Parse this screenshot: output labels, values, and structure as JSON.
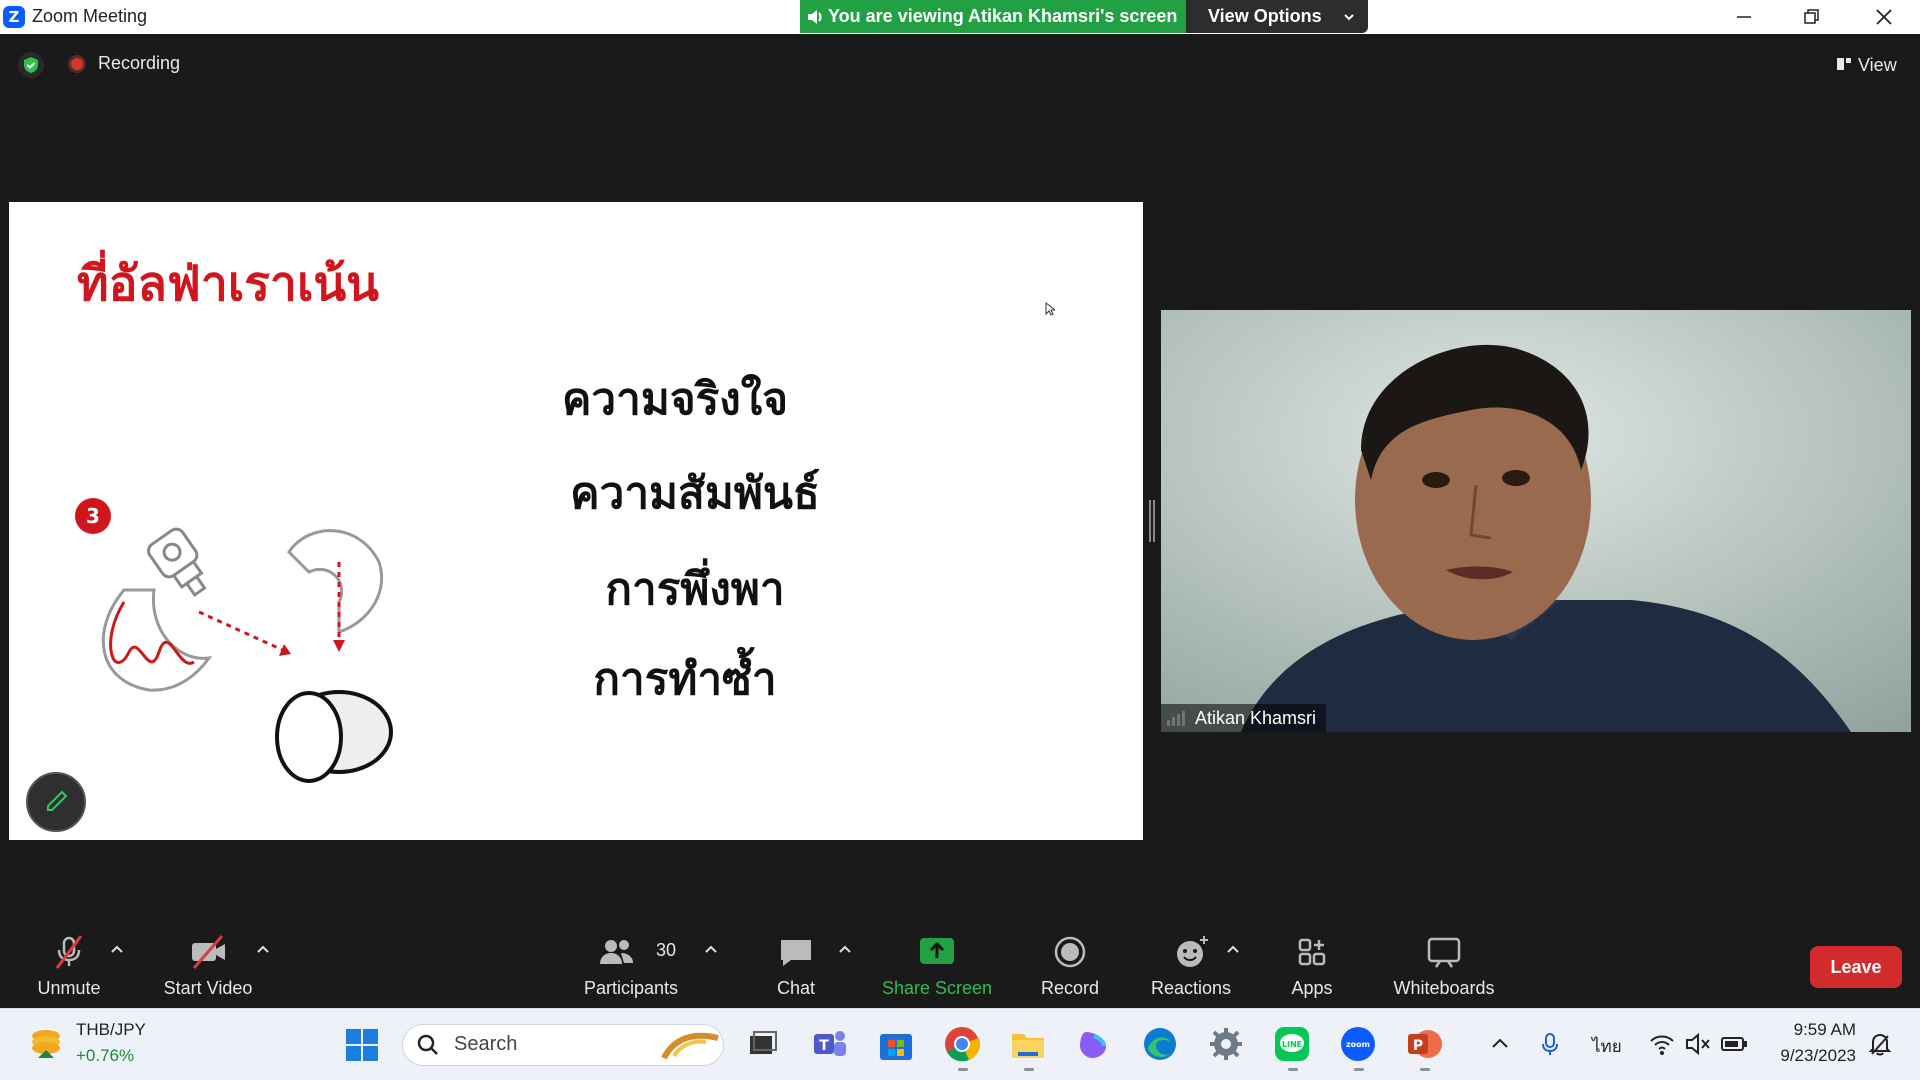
{
  "window": {
    "title": "Zoom Meeting",
    "logo_letter": "Z",
    "viewing_banner": "You are viewing Atikan Khamsri's screen",
    "view_options_label": "View Options"
  },
  "meeting_bar": {
    "recording_label": "Recording",
    "view_label": "View"
  },
  "slide": {
    "title": "ที่อัลฟ่าเราเน้น",
    "lines": [
      "ความจริงใจ",
      "ความสัมพันธ์",
      "การพึ่งพา",
      "การทำซ้ำ"
    ],
    "step_number": "3",
    "accent_color": "#d0161c"
  },
  "video": {
    "participant_name": "Atikan Khamsri"
  },
  "toolbar": {
    "unmute": "Unmute",
    "start_video": "Start Video",
    "participants": "Participants",
    "participants_count": "30",
    "chat": "Chat",
    "share_screen": "Share Screen",
    "record": "Record",
    "reactions": "Reactions",
    "apps": "Apps",
    "whiteboards": "Whiteboards",
    "leave": "Leave",
    "share_color": "#22a044",
    "leave_color": "#d12b2b"
  },
  "taskbar": {
    "ticker_name": "THB/JPY",
    "ticker_change": "+0.76%",
    "search_placeholder": "Search",
    "language": "ไทย",
    "time": "9:59 AM",
    "date": "9/23/2023",
    "apps": [
      "windows-start-icon",
      "task-view-icon",
      "teams-icon",
      "microsoft-store-icon",
      "chrome-icon",
      "file-explorer-icon",
      "copilot-icon",
      "edge-icon",
      "settings-icon",
      "line-icon",
      "zoom-icon",
      "powerpoint-icon"
    ]
  }
}
